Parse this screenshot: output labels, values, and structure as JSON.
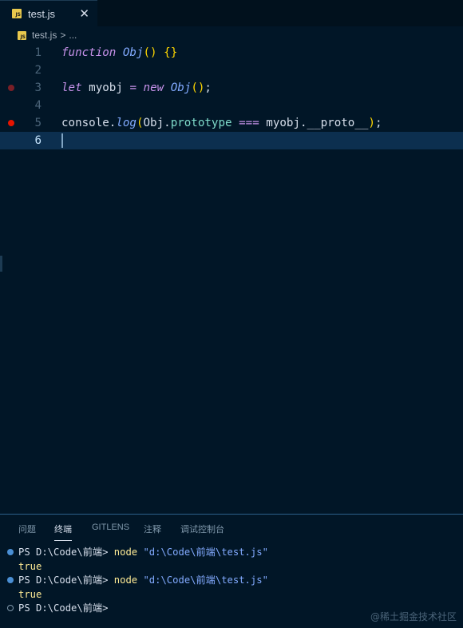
{
  "tab": {
    "badge": "JS",
    "filename": "test.js",
    "close_glyph": "✕"
  },
  "breadcrumb": {
    "badge": "JS",
    "file": "test.js",
    "separator": ">",
    "more": "..."
  },
  "editor": {
    "lines": [
      {
        "number": "1",
        "breakpoint": "none",
        "active": false,
        "tokens": [
          [
            "kw",
            "function"
          ],
          [
            "pl",
            " "
          ],
          [
            "fn",
            "Obj"
          ],
          [
            "br",
            "()"
          ],
          [
            "pl",
            " "
          ],
          [
            "br",
            "{}"
          ]
        ]
      },
      {
        "number": "2",
        "breakpoint": "none",
        "active": false,
        "tokens": []
      },
      {
        "number": "3",
        "breakpoint": "dim",
        "active": false,
        "tokens": [
          [
            "kw",
            "let"
          ],
          [
            "pl",
            " "
          ],
          [
            "var",
            "myobj"
          ],
          [
            "pl",
            " "
          ],
          [
            "op",
            "="
          ],
          [
            "pl",
            " "
          ],
          [
            "kw",
            "new"
          ],
          [
            "pl",
            " "
          ],
          [
            "fn",
            "Obj"
          ],
          [
            "br",
            "()"
          ],
          [
            "pl",
            ";"
          ]
        ]
      },
      {
        "number": "4",
        "breakpoint": "none",
        "active": false,
        "tokens": []
      },
      {
        "number": "5",
        "breakpoint": "bright",
        "active": false,
        "tokens": [
          [
            "var",
            "console"
          ],
          [
            "pl",
            "."
          ],
          [
            "fn",
            "log"
          ],
          [
            "br",
            "("
          ],
          [
            "var",
            "Obj"
          ],
          [
            "pl",
            "."
          ],
          [
            "prop",
            "prototype"
          ],
          [
            "pl",
            " "
          ],
          [
            "op",
            "==="
          ],
          [
            "pl",
            " "
          ],
          [
            "var",
            "myobj"
          ],
          [
            "pl",
            "."
          ],
          [
            "var",
            "__proto__"
          ],
          [
            "br",
            ")"
          ],
          [
            "pl",
            ";"
          ]
        ]
      },
      {
        "number": "6",
        "breakpoint": "none",
        "active": true,
        "tokens": []
      }
    ]
  },
  "panel": {
    "tabs": [
      {
        "label": "问题",
        "active": false
      },
      {
        "label": "终端",
        "active": true
      },
      {
        "label": "GITLENS",
        "active": false
      },
      {
        "label": "注释",
        "active": false
      },
      {
        "label": "调试控制台",
        "active": false
      }
    ],
    "terminal": [
      {
        "marker": "filled",
        "prompt": "PS D:\\Code\\前端> ",
        "command": "node",
        "arg": " \"d:\\Code\\前端\\test.js\"",
        "output": ""
      },
      {
        "marker": "none",
        "prompt": "",
        "command": "",
        "arg": "",
        "output": "true"
      },
      {
        "marker": "filled",
        "prompt": "PS D:\\Code\\前端> ",
        "command": "node",
        "arg": " \"d:\\Code\\前端\\test.js\"",
        "output": ""
      },
      {
        "marker": "none",
        "prompt": "",
        "command": "",
        "arg": "",
        "output": "true"
      },
      {
        "marker": "hollow",
        "prompt": "PS D:\\Code\\前端> ",
        "command": "",
        "arg": "",
        "output": ""
      }
    ]
  },
  "watermark": "@稀土掘金技术社区",
  "colors": {
    "background": "#011627",
    "accent": "#82aaff",
    "keyword": "#c792ea",
    "bracket": "#ffd700"
  }
}
